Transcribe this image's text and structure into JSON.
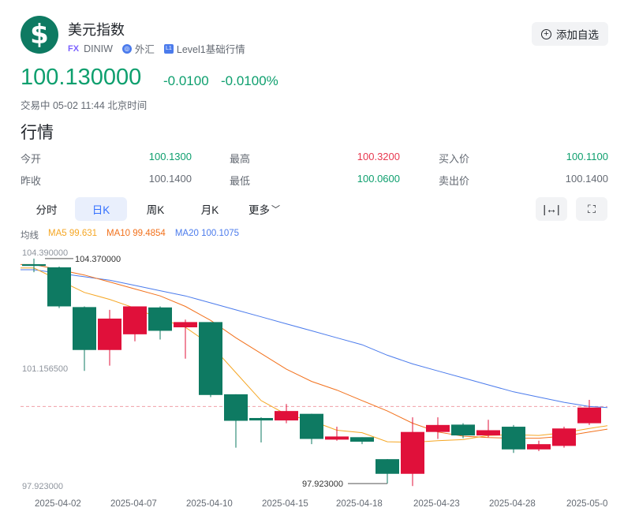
{
  "header": {
    "title": "美元指数",
    "tag": "FX",
    "code": "DINIW",
    "market_icon": "globe-icon",
    "market": "外汇",
    "level_icon": "L1",
    "level": "Level1基础行情",
    "add_watchlist": "添加自选"
  },
  "quote": {
    "price": "100.130000",
    "change": "-0.0100",
    "change_pct": "-0.0100%",
    "status": "交易中 05-02 11:44 北京时间"
  },
  "section_title": "行情",
  "stats": [
    {
      "label": "今开",
      "value": "100.1300",
      "color": "green"
    },
    {
      "label": "最高",
      "value": "100.3200",
      "color": "red"
    },
    {
      "label": "买入价",
      "value": "100.1100",
      "color": "green"
    },
    {
      "label": "昨收",
      "value": "100.1400",
      "color": "grey"
    },
    {
      "label": "最低",
      "value": "100.0600",
      "color": "green"
    },
    {
      "label": "卖出价",
      "value": "100.1400",
      "color": "grey"
    }
  ],
  "tabs": [
    {
      "label": "分时",
      "active": false
    },
    {
      "label": "日K",
      "active": true
    },
    {
      "label": "周K",
      "active": false
    },
    {
      "label": "月K",
      "active": false
    },
    {
      "label": "更多",
      "active": false
    }
  ],
  "tools": {
    "fit_icon": "fit-width-icon",
    "fullscreen_icon": "fullscreen-icon"
  },
  "ma": {
    "label": "均线",
    "ma5": "MA5 99.631",
    "ma10": "MA10 99.4854",
    "ma20": "MA20 100.1075",
    "colors": {
      "ma5": "#f5a623",
      "ma10": "#f2711c",
      "ma20": "#4b7bec"
    }
  },
  "chart_data": {
    "type": "candlestick",
    "y_axis_labels": [
      "104.390000",
      "101.156500",
      "97.923000"
    ],
    "y_range": [
      97.923,
      104.39
    ],
    "x_labels": [
      "2025-04-02",
      "2025-04-07",
      "2025-04-10",
      "2025-04-15",
      "2025-04-18",
      "2025-04-23",
      "2025-04-28",
      "2025-05-0"
    ],
    "high_annotation": "104.370000",
    "low_annotation": "97.923000",
    "current_price": 100.13,
    "colors": {
      "up": "#e0103a",
      "down": "#0e7a62"
    },
    "candles": [
      {
        "o": 104.21,
        "c": 104.16,
        "h": 104.37,
        "l": 103.98
      },
      {
        "o": 104.12,
        "c": 103.0,
        "h": 104.14,
        "l": 102.95
      },
      {
        "o": 102.98,
        "c": 101.75,
        "h": 103.0,
        "l": 101.15
      },
      {
        "o": 101.75,
        "c": 102.65,
        "h": 102.9,
        "l": 101.3
      },
      {
        "o": 102.2,
        "c": 103.0,
        "h": 103.0,
        "l": 102.0
      },
      {
        "o": 102.97,
        "c": 102.3,
        "h": 103.0,
        "l": 102.05
      },
      {
        "o": 102.4,
        "c": 102.55,
        "h": 102.62,
        "l": 101.5
      },
      {
        "o": 102.55,
        "c": 100.46,
        "h": 102.55,
        "l": 100.4
      },
      {
        "o": 100.48,
        "c": 99.72,
        "h": 100.48,
        "l": 98.95
      },
      {
        "o": 99.8,
        "c": 99.73,
        "h": 99.82,
        "l": 99.1
      },
      {
        "o": 99.73,
        "c": 100.0,
        "h": 100.2,
        "l": 99.65
      },
      {
        "o": 99.92,
        "c": 99.2,
        "h": 99.92,
        "l": 99.05
      },
      {
        "o": 99.18,
        "c": 99.27,
        "h": 99.55,
        "l": 99.15
      },
      {
        "o": 99.25,
        "c": 99.12,
        "h": 99.25,
        "l": 99.05
      },
      {
        "o": 98.62,
        "c": 98.2,
        "h": 98.62,
        "l": 97.92
      },
      {
        "o": 98.2,
        "c": 99.4,
        "h": 99.82,
        "l": 97.85
      },
      {
        "o": 99.4,
        "c": 99.6,
        "h": 99.82,
        "l": 99.2
      },
      {
        "o": 99.61,
        "c": 99.3,
        "h": 99.65,
        "l": 99.22
      },
      {
        "o": 99.3,
        "c": 99.45,
        "h": 99.75,
        "l": 99.25
      },
      {
        "o": 99.55,
        "c": 98.9,
        "h": 99.6,
        "l": 98.8
      },
      {
        "o": 98.9,
        "c": 99.05,
        "h": 99.15,
        "l": 98.85
      },
      {
        "o": 99.0,
        "c": 99.5,
        "h": 99.55,
        "l": 98.95
      },
      {
        "o": 99.65,
        "c": 100.1,
        "h": 100.32,
        "l": 99.6
      }
    ],
    "ma5": [
      104.1,
      103.75,
      103.4,
      103.2,
      102.95,
      102.65,
      102.4,
      101.9,
      101.1,
      100.3,
      99.9,
      99.72,
      99.45,
      99.38,
      99.12,
      99.1,
      99.15,
      99.18,
      99.3,
      99.32,
      99.3,
      99.38,
      99.5
    ],
    "ma10": [
      104.2,
      104.05,
      103.9,
      103.7,
      103.5,
      103.3,
      103.0,
      102.6,
      102.1,
      101.65,
      101.2,
      100.85,
      100.6,
      100.3,
      100.0,
      99.65,
      99.4,
      99.28,
      99.24,
      99.22,
      99.22,
      99.28,
      99.4
    ],
    "ma20": [
      104.05,
      103.95,
      103.85,
      103.75,
      103.6,
      103.45,
      103.3,
      103.1,
      102.9,
      102.7,
      102.5,
      102.3,
      102.1,
      101.9,
      101.6,
      101.35,
      101.15,
      100.95,
      100.75,
      100.55,
      100.4,
      100.25,
      100.13
    ]
  }
}
